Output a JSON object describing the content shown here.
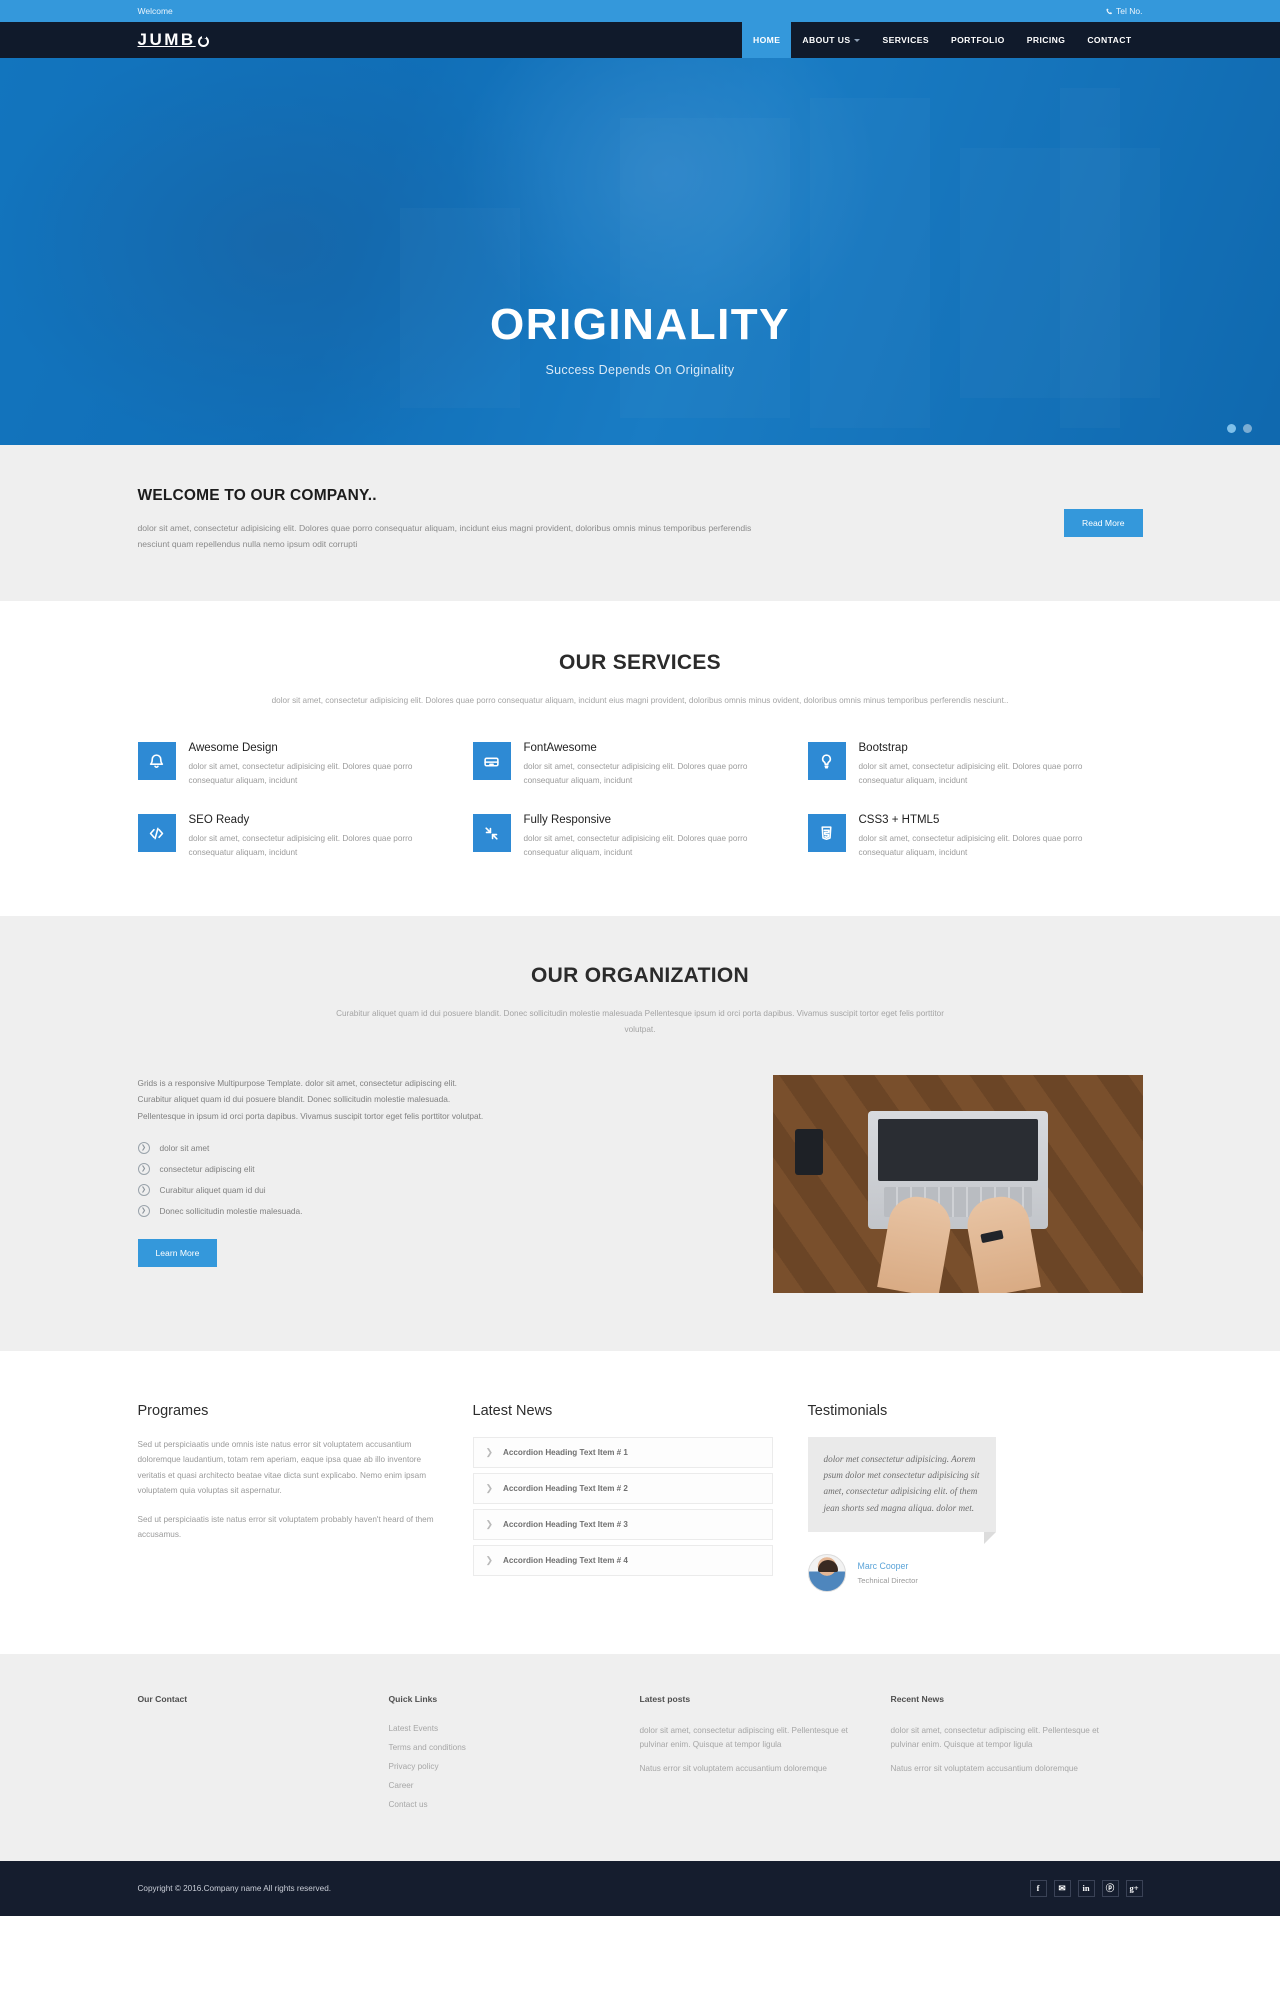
{
  "topbar": {
    "welcome": "Welcome",
    "tel_label": "Tel No."
  },
  "header": {
    "logo": "JUMB",
    "nav": [
      {
        "label": "HOME",
        "active": true,
        "caret": false
      },
      {
        "label": "ABOUT US",
        "active": false,
        "caret": true
      },
      {
        "label": "SERVICES",
        "active": false,
        "caret": false
      },
      {
        "label": "PORTFOLIO",
        "active": false,
        "caret": false
      },
      {
        "label": "PRICING",
        "active": false,
        "caret": false
      },
      {
        "label": "CONTACT",
        "active": false,
        "caret": false
      }
    ]
  },
  "hero": {
    "title": "ORIGINALITY",
    "subtitle": "Success Depends On Originality",
    "slides": 2,
    "active_slide": 1
  },
  "welcome": {
    "heading": "WELCOME TO OUR COMPANY..",
    "paragraph": "dolor sit amet, consectetur adipisicing elit. Dolores quae porro consequatur aliquam, incidunt eius magni provident, doloribus omnis minus temporibus perferendis nesciunt quam repellendus nulla nemo ipsum odit corrupti",
    "button": "Read More"
  },
  "services": {
    "heading": "OUR SERVICES",
    "subheading": "dolor sit amet, consectetur adipisicing elit. Dolores quae porro consequatur aliquam, incidunt eius magni provident, doloribus omnis minus ovident, doloribus omnis minus temporibus perferendis nesciunt..",
    "body": "dolor sit amet, consectetur adipisicing elit. Dolores quae porro consequatur aliquam, incidunt",
    "items": [
      {
        "title": "Awesome Design",
        "icon": "bell-icon"
      },
      {
        "title": "FontAwesome",
        "icon": "drawer-icon"
      },
      {
        "title": "Bootstrap",
        "icon": "lightbulb-icon"
      },
      {
        "title": "SEO Ready",
        "icon": "code-icon"
      },
      {
        "title": "Fully Responsive",
        "icon": "compress-icon"
      },
      {
        "title": "CSS3 + HTML5",
        "icon": "html5-icon"
      }
    ]
  },
  "organization": {
    "heading": "OUR ORGANIZATION",
    "subheading": "Curabitur aliquet quam id dui posuere blandit. Donec sollicitudin molestie malesuada Pellentesque ipsum id orci porta dapibus. Vivamus suscipit tortor eget felis porttitor volutpat.",
    "paragraph": "Grids is a responsive Multipurpose Template. dolor sit amet, consectetur adipiscing elit. Curabitur aliquet quam id dui posuere blandit. Donec sollicitudin molestie malesuada. Pellentesque in ipsum id orci porta dapibus. Vivamus suscipit tortor eget felis porttitor volutpat.",
    "list": [
      "dolor sit amet",
      "consectetur adipiscing elit",
      "Curabitur aliquet quam id dui",
      "Donec sollicitudin molestie malesuada."
    ],
    "button": "Learn More"
  },
  "programes": {
    "heading": "Programes",
    "paragraph1": "Sed ut perspiciaatis unde omnis iste natus error sit voluptatem accusantium doloremque laudantium, totam rem aperiam, eaque ipsa quae ab illo inventore veritatis et quasi architecto beatae vitae dicta sunt explicabo. Nemo enim ipsam voluptatem quia voluptas sit aspernatur.",
    "paragraph2": "Sed ut perspiciaatis iste natus error sit voluptatem probably haven't heard of them accusamus."
  },
  "latest_news": {
    "heading": "Latest News",
    "items": [
      "Accordion Heading Text Item # 1",
      "Accordion Heading Text Item # 2",
      "Accordion Heading Text Item # 3",
      "Accordion Heading Text Item # 4"
    ]
  },
  "testimonials": {
    "heading": "Testimonials",
    "quote": "dolor met consectetur adipisicing. Aorem psum dolor met consectetur adipisicing sit amet, consectetur adipisicing elit. of them jean shorts sed magna aliqua. dolor met.",
    "author_name": "Marc Cooper",
    "author_role": "Technical Director"
  },
  "footer": {
    "columns": [
      {
        "title": "Our Contact",
        "links": [],
        "paras": []
      },
      {
        "title": "Quick Links",
        "links": [
          "Latest Events",
          "Terms and conditions",
          "Privacy policy",
          "Career",
          "Contact us"
        ],
        "paras": []
      },
      {
        "title": "Latest posts",
        "links": [],
        "paras": [
          "dolor sit amet, consectetur adipiscing elit. Pellentesque et pulvinar enim. Quisque at tempor ligula",
          "Natus error sit voluptatem accusantium doloremque"
        ]
      },
      {
        "title": "Recent News",
        "links": [],
        "paras": [
          "dolor sit amet, consectetur adipiscing elit. Pellentesque et pulvinar enim. Quisque at tempor ligula",
          "Natus error sit voluptatem accusantium doloremque"
        ]
      }
    ],
    "copyright": "Copyright © 2016.Company name All rights reserved.",
    "social": [
      {
        "icon": "facebook-icon",
        "glyph": "f"
      },
      {
        "icon": "twitter-icon",
        "glyph": "✉"
      },
      {
        "icon": "linkedin-icon",
        "glyph": "in"
      },
      {
        "icon": "pinterest-icon",
        "glyph": "ⓟ"
      },
      {
        "icon": "google-plus-icon",
        "glyph": "g+"
      }
    ]
  },
  "colors": {
    "accent": "#3498db",
    "dark": "#101a2b",
    "footer_dark": "#151d2e",
    "light_gray": "#efefef"
  }
}
